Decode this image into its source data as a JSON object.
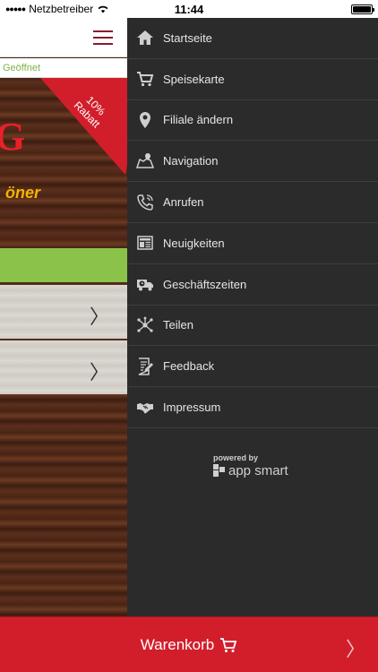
{
  "status_bar": {
    "carrier": "Netzbetreiber",
    "time": "11:44"
  },
  "main": {
    "open_status": "Geöffnet",
    "ribbon_line1": "10%",
    "ribbon_line2": "Rabatt",
    "hero_letter": "G",
    "hero_script": "öner"
  },
  "menu": {
    "items": [
      {
        "label": "Startseite",
        "icon": "home-icon"
      },
      {
        "label": "Speisekarte",
        "icon": "cart-icon"
      },
      {
        "label": "Filiale ändern",
        "icon": "location-pin-icon"
      },
      {
        "label": "Navigation",
        "icon": "map-icon"
      },
      {
        "label": "Anrufen",
        "icon": "phone-icon"
      },
      {
        "label": "Neuigkeiten",
        "icon": "newspaper-icon"
      },
      {
        "label": "Geschäftszeiten",
        "icon": "delivery-truck-icon"
      },
      {
        "label": "Teilen",
        "icon": "share-icon"
      },
      {
        "label": "Feedback",
        "icon": "feedback-icon"
      },
      {
        "label": "Impressum",
        "icon": "handshake-icon"
      }
    ]
  },
  "powered": {
    "label": "powered by",
    "brand": "app smart"
  },
  "cart": {
    "label": "Warenkorb"
  },
  "colors": {
    "accent_red": "#d21e2b",
    "drawer_bg": "#2b2b2b",
    "open_green": "#7cb342",
    "hamburger": "#8b1a2b"
  }
}
